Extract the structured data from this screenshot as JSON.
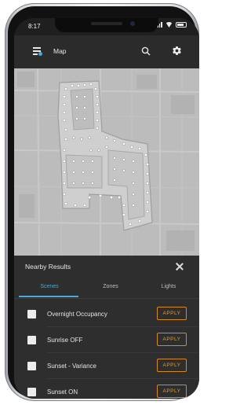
{
  "status": {
    "time": "8:17"
  },
  "appbar": {
    "title": "Map"
  },
  "sheet": {
    "title": "Nearby Results",
    "tabs": [
      {
        "label": "Scenes"
      },
      {
        "label": "Zones"
      },
      {
        "label": "Lights"
      }
    ],
    "active_tab": "Scenes",
    "items": [
      {
        "label": "Overnight Occupancy",
        "action": "APPLY"
      },
      {
        "label": "Sunrise OFF",
        "action": "APPLY"
      },
      {
        "label": "Sunset - Variance",
        "action": "APPLY"
      },
      {
        "label": "Sunset ON",
        "action": "APPLY"
      }
    ]
  },
  "colors": {
    "accent": "#4aa8da",
    "apply": "#e09a33",
    "sheet_bg": "#2e2e2e",
    "map_bg": "#bdbdbd"
  }
}
